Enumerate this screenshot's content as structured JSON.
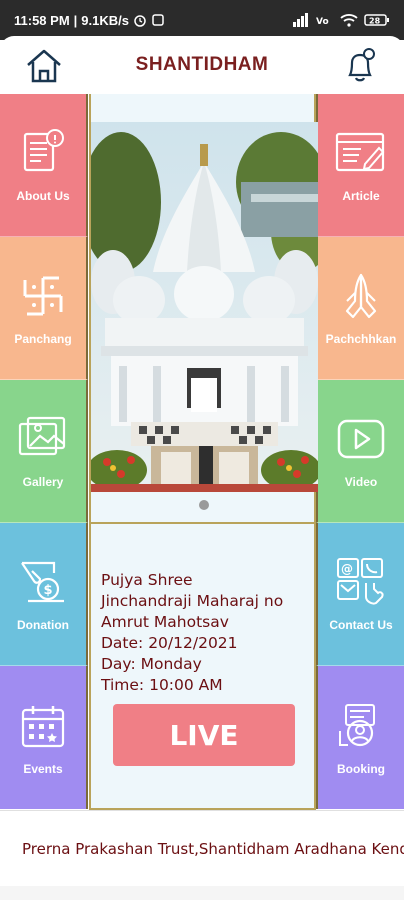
{
  "statusbar": {
    "time": "11:58 PM",
    "net_speed": "9.1KB/s",
    "battery": "28"
  },
  "header": {
    "title": "SHANTIDHAM",
    "home_icon": "home-icon",
    "bell_icon": "bell-icon"
  },
  "tiles_left": [
    {
      "label": "About Us",
      "icon": "document-info-icon"
    },
    {
      "label": "Panchang",
      "icon": "swastika-icon"
    },
    {
      "label": "Gallery",
      "icon": "image-gallery-icon"
    },
    {
      "label": "Donation",
      "icon": "hand-coin-icon"
    },
    {
      "label": "Events",
      "icon": "calendar-icon"
    }
  ],
  "tiles_right": [
    {
      "label": "Article",
      "icon": "article-edit-icon"
    },
    {
      "label": "Pachchhkan",
      "icon": "praying-hands-icon"
    },
    {
      "label": "Video",
      "icon": "play-video-icon"
    },
    {
      "label": "Contact Us",
      "icon": "contact-icon"
    },
    {
      "label": "Booking",
      "icon": "booking-icon"
    }
  ],
  "event": {
    "line1": "Pujya Shree",
    "line2": "Jinchandraji Maharaj no",
    "line3": "Amrut Mahotsav",
    "date": "Date: 20/12/2021",
    "day": "Day: Monday",
    "time": "Time: 10:00 AM"
  },
  "live_label": "LIVE",
  "footer_text": "Prerna Prakashan Trust,Shantidham Aradhana Kendra",
  "colors": {
    "pink": "#f07f86",
    "peach": "#f8b78e",
    "green": "#88d58c",
    "blue": "#6cc1dd",
    "purple": "#a08cf1",
    "title": "#7a1f1f"
  }
}
